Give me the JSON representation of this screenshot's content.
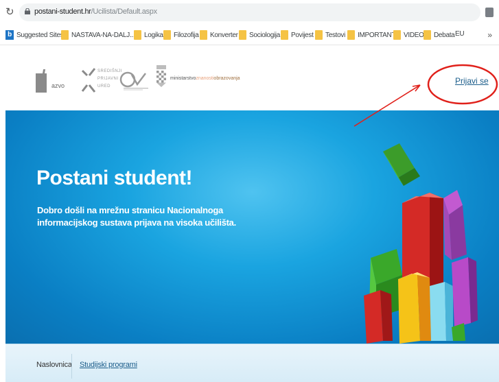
{
  "browser": {
    "url_host": "postani-student.hr",
    "url_path": "/Ucilista/Default.aspx",
    "reload_icon": "reload-icon",
    "lock_icon": "lock-icon",
    "extension_icon": "extension-icon"
  },
  "bookmarks": {
    "items": [
      {
        "label": "Suggested Sites",
        "icon": "bing-icon"
      },
      {
        "label": "NASTAVA-NA-DALJ...",
        "icon": "folder-icon"
      },
      {
        "label": "Logika",
        "icon": "folder-icon"
      },
      {
        "label": "Filozofija",
        "icon": "folder-icon"
      },
      {
        "label": "Konverter",
        "icon": "folder-icon"
      },
      {
        "label": "Sociologija",
        "icon": "folder-icon"
      },
      {
        "label": "Povijest",
        "icon": "folder-icon"
      },
      {
        "label": "Testovi",
        "icon": "folder-icon"
      },
      {
        "label": "IMPORTANT",
        "icon": "folder-icon"
      },
      {
        "label": "VIDEO",
        "icon": "folder-icon"
      },
      {
        "label": "Debata",
        "icon": "folder-icon"
      },
      {
        "label": "EU",
        "icon": ""
      }
    ],
    "more": "»"
  },
  "header": {
    "logo_azvo": "azvo",
    "logo_sdu_lines": [
      "SREDIŠNJI",
      "PRIJAVNI",
      "URED"
    ],
    "logo_ministry": {
      "part1": "ministarstvo",
      "part2": "znanosti",
      "part3": "obrazovanja"
    },
    "login_label": "Prijavi se"
  },
  "hero": {
    "title": "Postani student!",
    "text": "Dobro došli na mrežnu stranicu Nacionalnoga informacijskog sustava prijava na visoka učilišta."
  },
  "nav": {
    "items": [
      {
        "label": "Naslovnica"
      },
      {
        "label": "Studijski programi"
      }
    ]
  },
  "colors": {
    "hero_blue": "#1aa4e0",
    "link": "#1a5c8a",
    "annotation_red": "#e0201a"
  }
}
